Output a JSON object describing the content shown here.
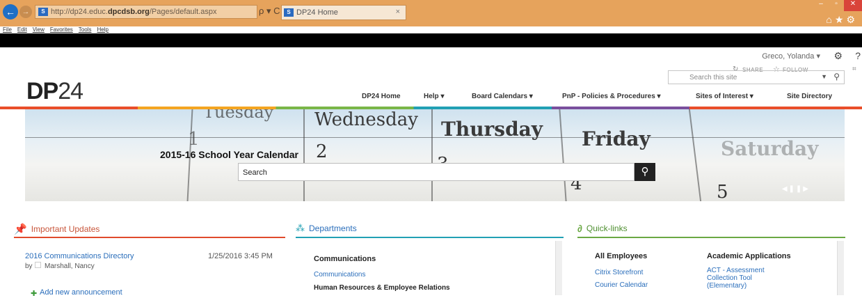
{
  "browser": {
    "url_prefix": "http://dp24.educ.",
    "url_domain": "dpcdsb.org",
    "url_path": "/Pages/default.aspx",
    "addr_tools": "ρ ▾ C",
    "tab_title": "DP24 Home",
    "tab_close": "×",
    "menu": [
      "File",
      "Edit",
      "View",
      "Favorites",
      "Tools",
      "Help"
    ]
  },
  "suite": {
    "user": "Greco, Yolanda ▾",
    "share": "SHARE",
    "follow": "FOLLOW"
  },
  "header": {
    "logo_bold": "DP",
    "logo_rest": "24",
    "search_placeholder": "Search this site",
    "nav": [
      "DP24 Home",
      "Help ▾",
      "Board Calendars ▾",
      "PnP - Policies & Procedures ▾",
      "Sites of Interest ▾",
      "Site Directory"
    ]
  },
  "banner": {
    "days": [
      "Tuesday",
      "Wednesday",
      "Thursday",
      "Friday",
      "Saturday"
    ],
    "numbers": [
      "1",
      "2",
      "3",
      "4",
      "5"
    ],
    "title": "2015-16 School Year Calendar",
    "search_value": "Search"
  },
  "updates": {
    "title": "Important Updates",
    "item_title": "2016 Communications Directory",
    "item_date": "1/25/2016 3:45 PM",
    "item_by": "by",
    "item_author": "Marshall, Nancy",
    "add_label": "Add new announcement"
  },
  "departments": {
    "title": "Departments",
    "heading1": "Communications",
    "link1": "Communications",
    "heading2": "Human Resources & Employee Relations"
  },
  "quicklinks": {
    "title": "Quick-links",
    "col1_heading": "All Employees",
    "col1_links": [
      "Citrix Storefront",
      "Courier Calendar"
    ],
    "col2_heading": "Academic Applications",
    "col2_link_lines": [
      "ACT - Assessment",
      "Collection Tool",
      "(Elementary)"
    ]
  },
  "colors": {
    "updates_accent": "#e04a2c",
    "departments_accent": "#21a0b4",
    "quicklinks_accent": "#6aa843",
    "link": "#2a6ebb"
  }
}
